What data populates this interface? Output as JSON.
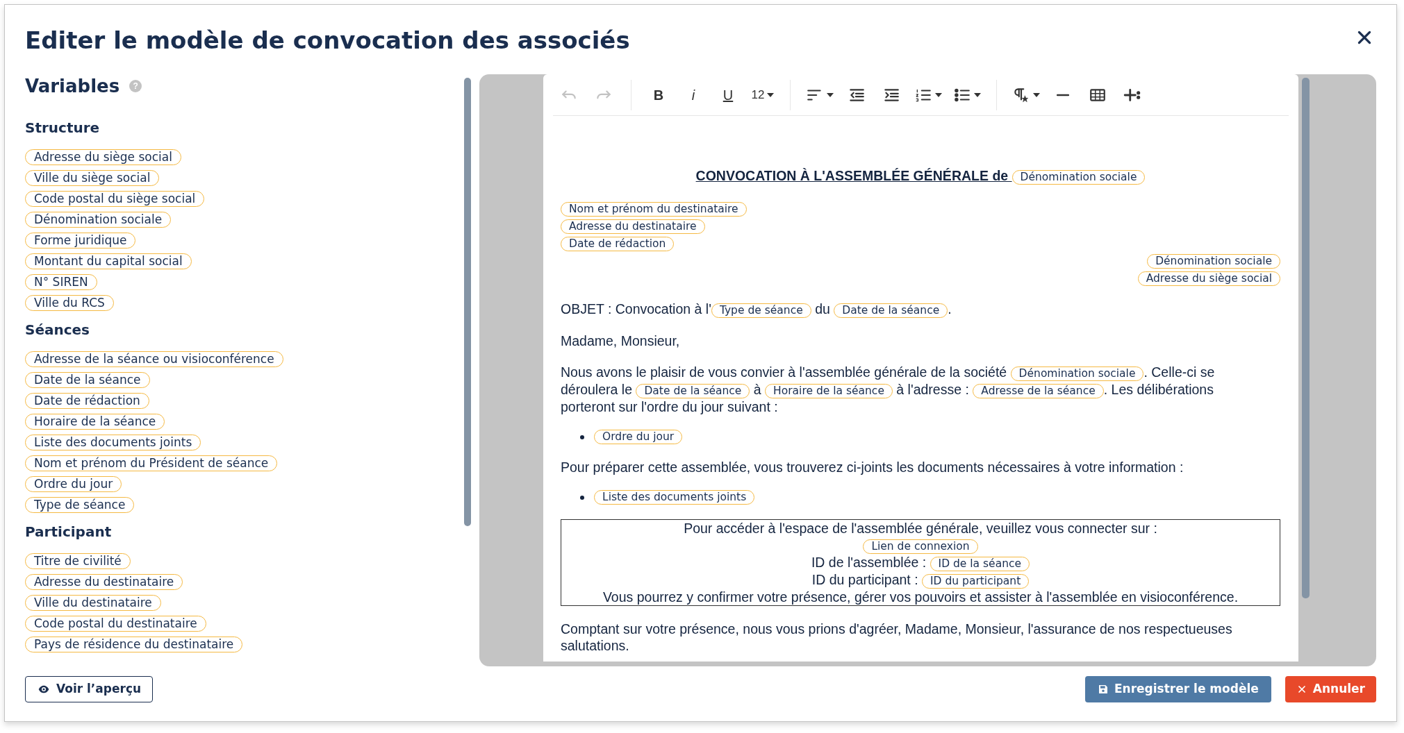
{
  "title": "Editer le modèle de convocation des associés",
  "variables": {
    "heading": "Variables",
    "help": "?",
    "groups": [
      {
        "name": "Structure",
        "items": [
          "Adresse du siège social",
          "Ville du siège social",
          "Code postal du siège social",
          "Dénomination sociale",
          "Forme juridique",
          "Montant du capital social",
          "N° SIREN",
          "Ville du RCS"
        ]
      },
      {
        "name": "Séances",
        "items": [
          "Adresse de la séance ou visioconférence",
          "Date de la séance",
          "Date de rédaction",
          "Horaire de la séance",
          "Liste des documents joints",
          "Nom et prénom du Président de séance",
          "Ordre du jour",
          "Type de séance"
        ]
      },
      {
        "name": "Participant",
        "items": [
          "Titre de civilité",
          "Adresse du destinataire",
          "Ville du destinataire",
          "Code postal du destinataire",
          "Pays de résidence du destinataire"
        ]
      }
    ]
  },
  "toolbar": [
    [
      {
        "kind": "undo",
        "disabled": true
      },
      {
        "kind": "redo",
        "disabled": true
      }
    ],
    [
      {
        "kind": "bold",
        "label": "B"
      },
      {
        "kind": "italic",
        "label": "i"
      },
      {
        "kind": "underline",
        "label": "U"
      },
      {
        "kind": "size",
        "label": "12",
        "dropdown": true
      }
    ],
    [
      {
        "kind": "align",
        "dropdown": true
      },
      {
        "kind": "outdent"
      },
      {
        "kind": "indent"
      },
      {
        "kind": "ordered-list",
        "dropdown": true
      },
      {
        "kind": "bullet-list",
        "dropdown": true
      }
    ],
    [
      {
        "kind": "paragraph",
        "dropdown": true
      },
      {
        "kind": "rule"
      },
      {
        "kind": "table"
      },
      {
        "kind": "insert"
      }
    ]
  ],
  "document": [
    {
      "kind": "heading",
      "lines": [
        [
          {
            "kind": "text",
            "text": "CONVOCATION À L'ASSEMBLÉE GÉNÉRALE de "
          },
          {
            "kind": "var",
            "text": "Dénomination sociale"
          }
        ]
      ]
    },
    {
      "kind": "address-left",
      "lines": [
        [
          {
            "kind": "var",
            "text": "Nom et prénom du destinataire"
          }
        ],
        [
          {
            "kind": "var",
            "text": "Adresse du destinataire"
          }
        ],
        [
          {
            "kind": "var",
            "text": "Date de rédaction"
          }
        ]
      ]
    },
    {
      "kind": "address-right",
      "lines": [
        [
          {
            "kind": "var",
            "text": "Dénomination sociale"
          }
        ],
        [
          {
            "kind": "var",
            "text": "Adresse du siège social"
          }
        ]
      ]
    },
    {
      "kind": "paragraph",
      "lines": [
        [
          {
            "kind": "text",
            "text": "OBJET : Convocation à l'"
          },
          {
            "kind": "var",
            "text": "Type de séance"
          },
          {
            "kind": "text",
            "text": " du "
          },
          {
            "kind": "var",
            "text": "Date de la séance"
          },
          {
            "kind": "text",
            "text": "."
          }
        ]
      ]
    },
    {
      "kind": "paragraph",
      "lines": [
        [
          {
            "kind": "text",
            "text": "Madame, Monsieur,"
          }
        ]
      ]
    },
    {
      "kind": "paragraph",
      "lines": [
        [
          {
            "kind": "text",
            "text": "Nous avons le plaisir de vous convier à l'assemblée générale de la société "
          },
          {
            "kind": "var",
            "text": "Dénomination sociale"
          },
          {
            "kind": "text",
            "text": ". Celle-ci se"
          }
        ],
        [
          {
            "kind": "text",
            "text": "déroulera le "
          },
          {
            "kind": "var",
            "text": "Date de la séance"
          },
          {
            "kind": "text",
            "text": " à "
          },
          {
            "kind": "var",
            "text": "Horaire de la séance"
          },
          {
            "kind": "text",
            "text": " à l'adresse : "
          },
          {
            "kind": "var",
            "text": "Adresse de la séance"
          },
          {
            "kind": "text",
            "text": ". Les délibérations"
          }
        ],
        [
          {
            "kind": "text",
            "text": "porteront sur l'ordre du jour suivant :"
          }
        ]
      ]
    },
    {
      "kind": "bullet",
      "lines": [
        [
          {
            "kind": "var",
            "text": "Ordre du jour"
          }
        ]
      ]
    },
    {
      "kind": "paragraph",
      "lines": [
        [
          {
            "kind": "text",
            "text": "Pour préparer cette assemblée, vous trouverez ci-joints les documents nécessaires à votre information :"
          }
        ]
      ]
    },
    {
      "kind": "bullet",
      "lines": [
        [
          {
            "kind": "var",
            "text": "Liste des documents joints"
          }
        ]
      ]
    },
    {
      "kind": "box",
      "lines": [
        [
          {
            "kind": "text",
            "text": "Pour accéder à l'espace de l'assemblée générale, veuillez vous connecter sur :"
          }
        ],
        [
          {
            "kind": "var",
            "text": "Lien de connexion"
          }
        ],
        [
          {
            "kind": "text",
            "text": "ID de l'assemblée : "
          },
          {
            "kind": "var",
            "text": "ID de la séance"
          }
        ],
        [
          {
            "kind": "text",
            "text": "ID du participant : "
          },
          {
            "kind": "var",
            "text": "ID du participant"
          }
        ],
        [
          {
            "kind": "text",
            "text": "Vous pourrez y confirmer votre présence, gérer vos pouvoirs et assister à l'assemblée en visioconférence."
          }
        ]
      ]
    },
    {
      "kind": "paragraph",
      "lines": [
        [
          {
            "kind": "text",
            "text": "Comptant sur votre présence, nous vous prions d'agréer, Madame, Monsieur, l'assurance de nos respectueuses"
          }
        ],
        [
          {
            "kind": "text",
            "text": "salutations."
          }
        ]
      ]
    }
  ],
  "buttons": [
    {
      "kind": "preview",
      "label": "Voir l’aperçu"
    },
    {
      "kind": "save",
      "label": "Enregistrer le modèle"
    },
    {
      "kind": "cancel",
      "label": "Annuler"
    }
  ]
}
